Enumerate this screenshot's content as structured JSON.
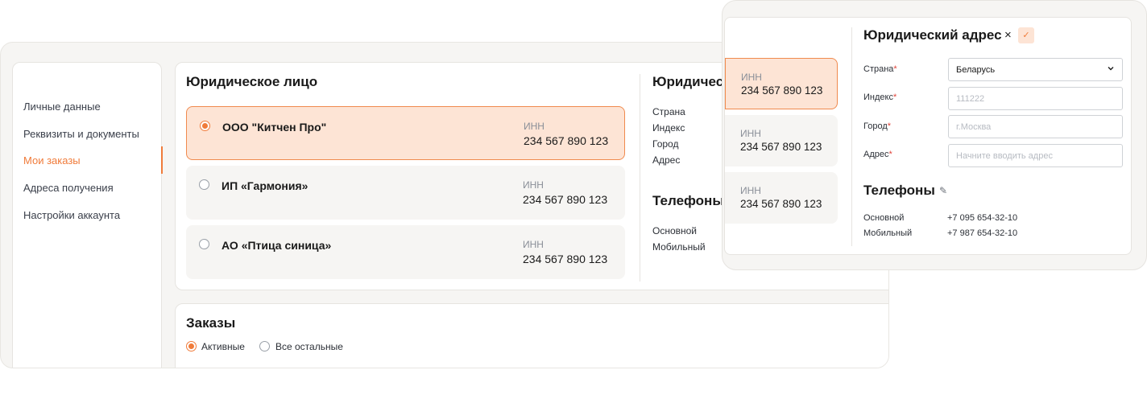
{
  "sidebar": {
    "items": [
      {
        "label": "Личные данные",
        "active": false
      },
      {
        "label": "Реквизиты и документы",
        "active": false
      },
      {
        "label": "Мои заказы",
        "active": true
      },
      {
        "label": "Адреса получения",
        "active": false
      },
      {
        "label": "Настройки аккаунта",
        "active": false
      }
    ]
  },
  "entity_panel": {
    "title": "Юридическое лицо",
    "entities": [
      {
        "name": "ООО \"Китчен Про\"",
        "inn_label": "ИНН",
        "inn": "234 567 890 123",
        "selected": true
      },
      {
        "name": "ИП «Гармония»",
        "inn_label": "ИНН",
        "inn": "234 567 890 123",
        "selected": false
      },
      {
        "name": "АО «Птица синица»",
        "inn_label": "ИНН",
        "inn": "234 567 890 123",
        "selected": false
      }
    ]
  },
  "address_preview": {
    "title": "Юридичес",
    "labels": [
      "Страна",
      "Индекс",
      "Город",
      "Адрес"
    ],
    "phones_title": "Телефоны",
    "phone_labels": [
      "Основной",
      "Мобильный"
    ]
  },
  "orders": {
    "title": "Заказы",
    "options": [
      {
        "label": "Активные",
        "selected": true
      },
      {
        "label": "Все остальные",
        "selected": false
      }
    ]
  },
  "overlay": {
    "cards": [
      {
        "inn_label": "ИНН",
        "inn": "234 567 890 123",
        "selected": true
      },
      {
        "inn_label": "ИНН",
        "inn": "234 567 890 123",
        "selected": false
      },
      {
        "inn_label": "ИНН",
        "inn": "234 567 890 123",
        "selected": false
      }
    ],
    "title": "Юридический адрес",
    "close_glyph": "×",
    "confirm_glyph": "✓",
    "required_mark": "*",
    "fields": [
      {
        "label": "Страна",
        "value": "Беларусь",
        "placeholder": "",
        "type": "select"
      },
      {
        "label": "Индекс",
        "value": "",
        "placeholder": "111222",
        "type": "input"
      },
      {
        "label": "Город",
        "value": "",
        "placeholder": "г.Москва",
        "type": "input"
      },
      {
        "label": "Адрес",
        "value": "",
        "placeholder": "Начните вводить адрес",
        "type": "input"
      }
    ],
    "phones_title": "Телефоны",
    "edit_glyph": "✎",
    "phones": [
      {
        "label": "Основной",
        "value": "+7 095 654-32-10"
      },
      {
        "label": "Мобильный",
        "value": "+7 987 654-32-10"
      }
    ]
  },
  "colors": {
    "accent": "#f07b3a",
    "selected_bg": "#fde4d5",
    "required": "#e0443a"
  }
}
